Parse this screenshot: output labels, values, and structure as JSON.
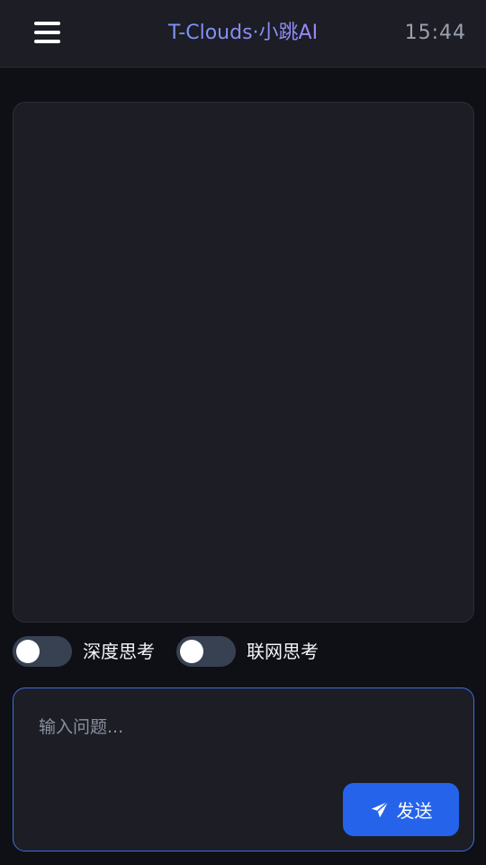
{
  "header": {
    "menu_icon": "hamburger-menu-icon",
    "title": "T-Clouds·小跳AI",
    "time": "15:44"
  },
  "toggles": [
    {
      "label": "深度思考",
      "on": false
    },
    {
      "label": "联网思考",
      "on": false
    }
  ],
  "input": {
    "placeholder": "输入问题...",
    "value": ""
  },
  "send": {
    "label": "发送",
    "icon": "paper-plane-icon"
  },
  "colors": {
    "accent": "#2563eb",
    "title_gradient_start": "#60a5fa",
    "title_gradient_end": "#c084fc",
    "background": "#0f1016",
    "panel": "#1c1d25"
  }
}
